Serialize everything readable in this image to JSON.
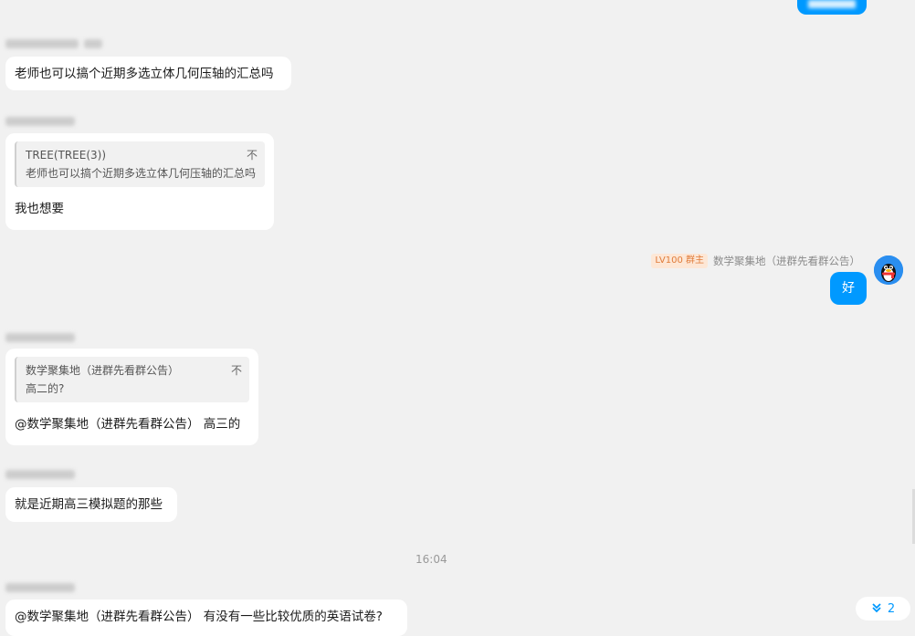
{
  "messages": {
    "m1_text": "老师也可以搞个近期多选立体几何压轴的汇总吗",
    "m2_quote_sender": "TREE(TREE(3))",
    "m2_quote_text": "老师也可以搞个近期多选立体几何压轴的汇总吗",
    "m2_text": "我也想要",
    "m3_badge": "LV100 群主",
    "m3_sender": "数学聚集地（进群先看群公告）",
    "m3_text": "好",
    "m4_quote_sender": "数学聚集地（进群先看群公告）",
    "m4_quote_text": "高二的?",
    "m4_text": "@数学聚集地（进群先看群公告） 高三的",
    "m5_text": "就是近期高三模拟题的那些",
    "time": "16:04",
    "m6_text": "@数学聚集地（进群先看群公告） 有没有一些比较优质的英语试卷?"
  },
  "quote_icon": "不",
  "unread_count": "2",
  "icons": {
    "avatar": "qq-penguin-avatar",
    "scroll": "double-chevron-down-icon"
  },
  "colors": {
    "bubble_blue": "#0099ff",
    "background": "#f1f1f1",
    "badge_bg": "#fde7d6",
    "badge_text": "#e07b39"
  }
}
